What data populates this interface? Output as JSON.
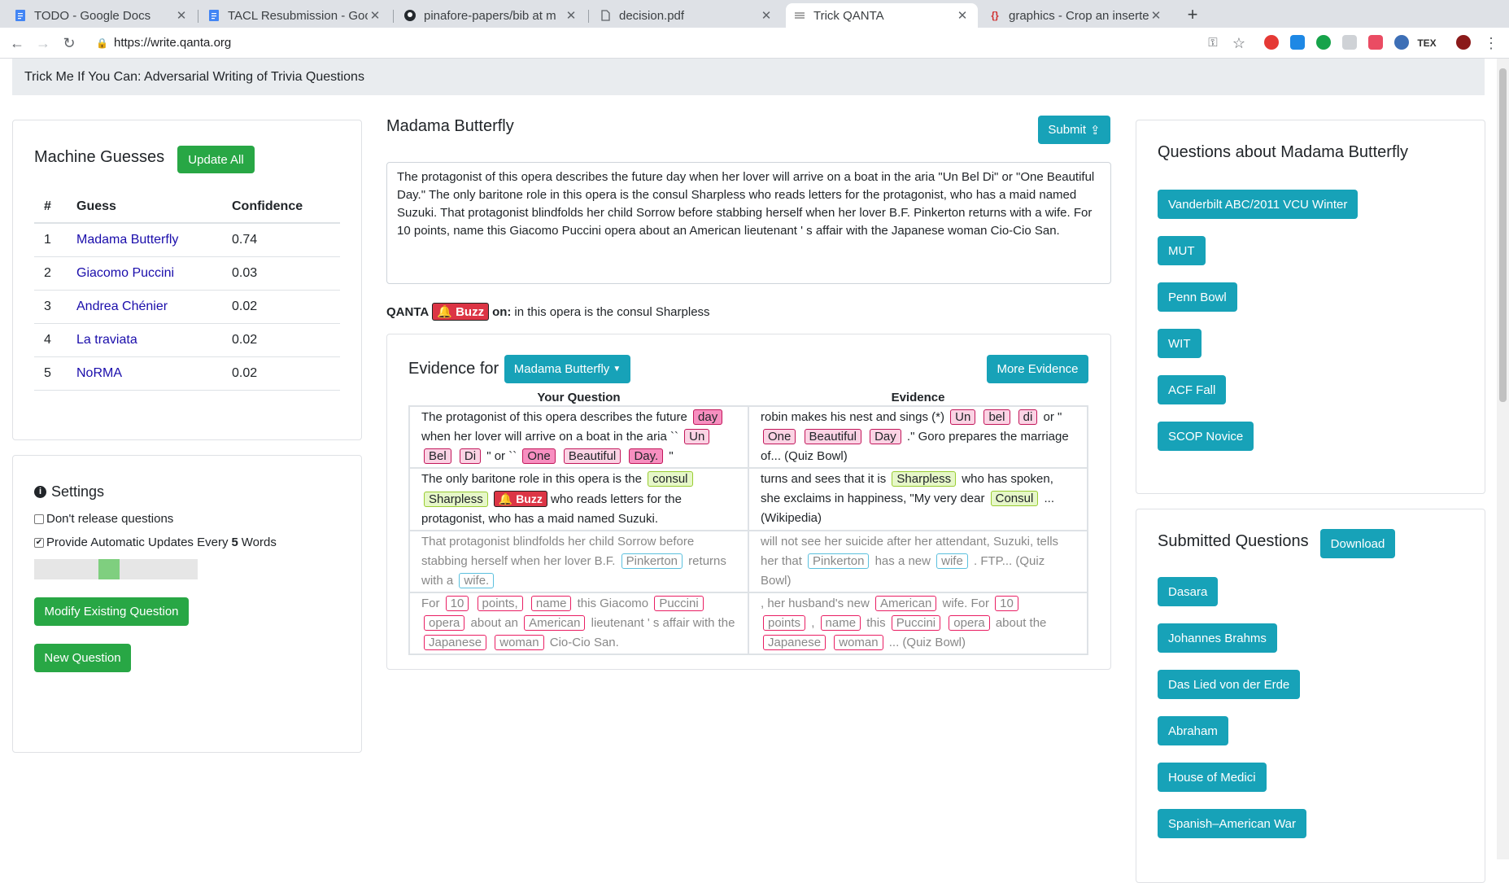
{
  "browser": {
    "tabs": [
      {
        "title": "TODO - Google Docs",
        "icon": "docs-icon"
      },
      {
        "title": "TACL Resubmission - Goo",
        "icon": "docs-icon"
      },
      {
        "title": "pinafore-papers/bib at m",
        "icon": "github-icon"
      },
      {
        "title": "decision.pdf",
        "icon": "file-icon"
      },
      {
        "title": "Trick QANTA",
        "icon": "page-icon"
      },
      {
        "title": "graphics - Crop an inserte",
        "icon": "overleaf-icon"
      }
    ],
    "url": "https://write.qanta.org"
  },
  "navbar": {
    "title": "Trick Me If You Can: Adversarial Writing of Trivia Questions"
  },
  "guesses": {
    "title": "Machine Guesses",
    "update_all": "Update All",
    "headers": [
      "#",
      "Guess",
      "Confidence"
    ],
    "rows": [
      {
        "n": "1",
        "guess": "Madama Butterfly",
        "conf": "0.74"
      },
      {
        "n": "2",
        "guess": "Giacomo Puccini",
        "conf": "0.03"
      },
      {
        "n": "3",
        "guess": "Andrea Chénier",
        "conf": "0.02"
      },
      {
        "n": "4",
        "guess": "La traviata",
        "conf": "0.02"
      },
      {
        "n": "5",
        "guess": "NoRMA",
        "conf": "0.02"
      }
    ]
  },
  "settings": {
    "title": "Settings",
    "dont_release": "Don't release questions",
    "auto_updates_pre": "Provide Automatic Updates Every ",
    "auto_updates_n": "5",
    "auto_updates_post": " Words",
    "slider_value": 0.45,
    "modify": "Modify Existing Question",
    "new": "New Question"
  },
  "editor": {
    "answer": "Madama Butterfly",
    "submit": "Submit",
    "question": "The protagonist of this opera describes the future day when her lover will arrive on a boat in the aria \"Un Bel Di\" or \"One Beautiful Day.\" The only baritone role in this opera is the consul Sharpless who reads letters for the protagonist, who has a maid named Suzuki. That protagonist blindfolds her child Sorrow before stabbing herself when her lover B.F. Pinkerton returns with a wife. For 10 points, name this Giacomo Puccini opera about an American lieutenant ' s affair with the Japanese woman Cio-Cio San.",
    "buzz_prefix": "QANTA",
    "buzz_label": "Buzz",
    "buzz_on": "on:",
    "buzz_text": "in this opera is the consul Sharpless"
  },
  "evidence": {
    "title": "Evidence for",
    "dropdown": "Madama Butterfly",
    "more": "More Evidence",
    "col_question": "Your Question",
    "col_evidence": "Evidence"
  },
  "right": {
    "questions_title": "Questions about Madama Butterfly",
    "questions": [
      "Vanderbilt ABC/2011 VCU Winter",
      "MUT",
      "Penn Bowl",
      "WIT",
      "ACF Fall",
      "SCOP Novice"
    ],
    "submitted_title": "Submitted Questions",
    "download": "Download",
    "submitted": [
      "Dasara",
      "Johannes Brahms",
      "Das Lied von der Erde",
      "Abraham",
      "House of Medici",
      "Spanish–American War"
    ]
  }
}
